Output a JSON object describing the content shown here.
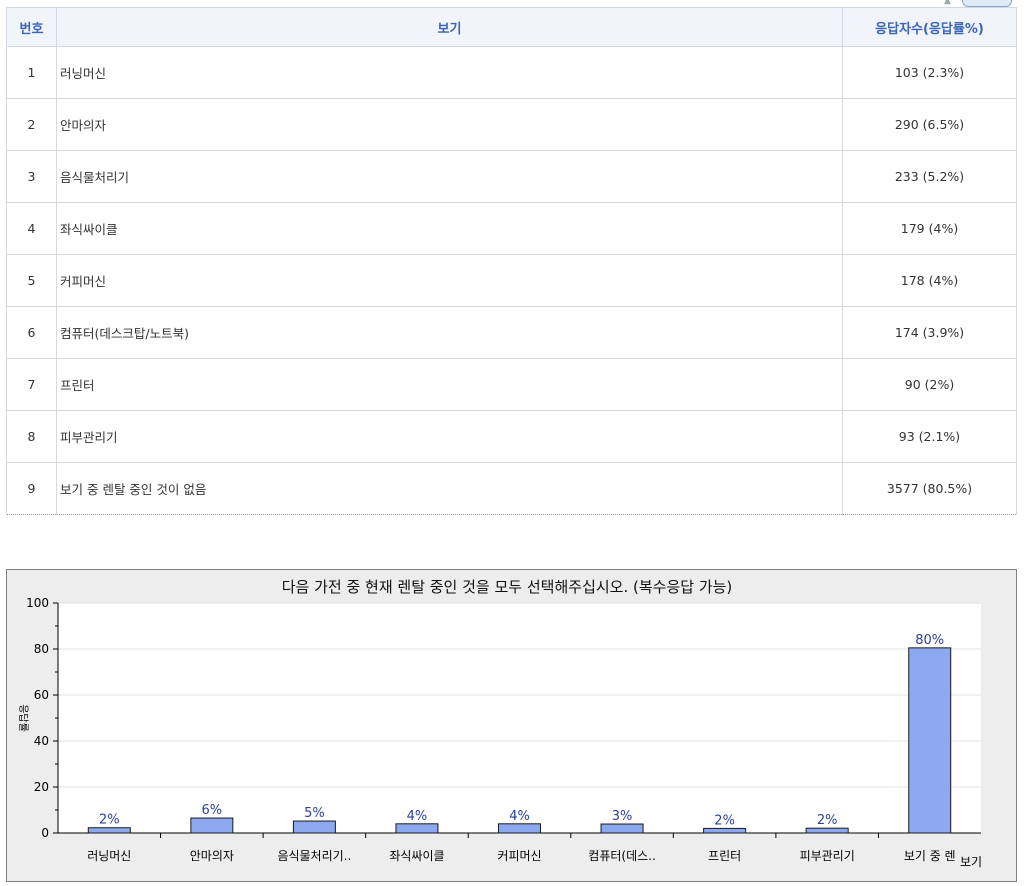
{
  "table": {
    "headers": {
      "no": "번호",
      "option": "보기",
      "count": "응답자수(응답률%)"
    },
    "rows": [
      {
        "no": "1",
        "option": "러닝머신",
        "count": "103 (2.3%)"
      },
      {
        "no": "2",
        "option": "안마의자",
        "count": "290 (6.5%)"
      },
      {
        "no": "3",
        "option": "음식물처리기",
        "count": "233 (5.2%)"
      },
      {
        "no": "4",
        "option": "좌식싸이클",
        "count": "179 (4%)"
      },
      {
        "no": "5",
        "option": "커피머신",
        "count": "178 (4%)"
      },
      {
        "no": "6",
        "option": "컴퓨터(데스크탑/노트북)",
        "count": "174 (3.9%)"
      },
      {
        "no": "7",
        "option": "프린터",
        "count": "90 (2%)"
      },
      {
        "no": "8",
        "option": "피부관리기",
        "count": "93 (2.1%)"
      },
      {
        "no": "9",
        "option": "보기 중 렌탈 중인 것이 없음",
        "count": "3577 (80.5%)"
      }
    ]
  },
  "chart_data": {
    "type": "bar",
    "title": "다음 가전 중 현재 렌탈 중인 것을 모두 선택해주십시오. (복수응답 가능)",
    "xlabel": "보기",
    "ylabel": "응답률",
    "ylim": [
      0,
      100
    ],
    "yticks": [
      "0",
      "20",
      "40",
      "60",
      "80",
      "100"
    ],
    "categories": [
      "러닝머신",
      "안마의자",
      "음식물처리기..",
      "좌식싸이클",
      "커피머신",
      "컴퓨터(데스..",
      "프린터",
      "피부관리기",
      "보기 중 렌"
    ],
    "values": [
      2.3,
      6.5,
      5.2,
      4,
      4,
      3.9,
      2,
      2.1,
      80.5
    ],
    "data_labels": [
      "2%",
      "6%",
      "5%",
      "4%",
      "4%",
      "3%",
      "2%",
      "2%",
      "80%"
    ],
    "grid": true,
    "colors": {
      "bar": "#8ca8ee",
      "bar_stroke": "#1a1a1a",
      "label": "#2b3f9e",
      "plot_bg": "#ffffff",
      "frame_bg": "#ededed"
    }
  }
}
